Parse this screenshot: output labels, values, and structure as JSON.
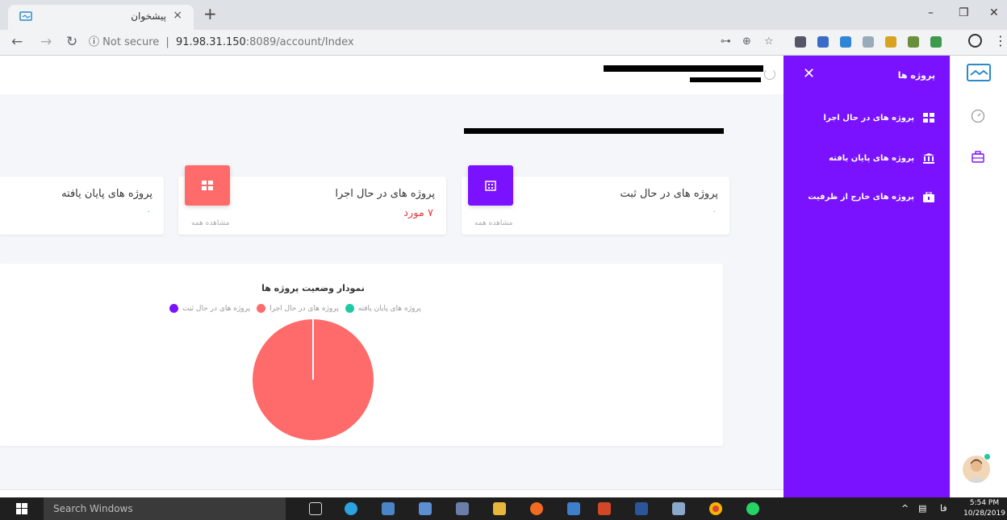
{
  "browser": {
    "tab_title": "پیشخوان",
    "tab_close": "×",
    "new_tab": "+",
    "url_security": "Not secure",
    "url_separator": "|",
    "url_host": "91.98.31.150",
    "url_rest": ":8089/account/Index",
    "window_controls": [
      "–",
      "❐",
      "✕"
    ]
  },
  "header": {},
  "cards": [
    {
      "title": "پروژه های در حال ثبت",
      "value": "۰",
      "link": "مشاهده همه",
      "badge_color": "#7a12ff"
    },
    {
      "title": "پروژه های در حال اجرا",
      "value": "۷ مورد",
      "link": "مشاهده همه",
      "badge_color": "#ff6a6a"
    },
    {
      "title": "پروژه های پایان یافته",
      "value": "۰",
      "link": "",
      "badge_color": "#ffffff"
    }
  ],
  "chart": {
    "title": "نمودار وضعیت پروژه ها",
    "legend": [
      {
        "label": "پروژه های پایان یافته",
        "color": "#1ec9a4"
      },
      {
        "label": "پروژه های در حال اجرا",
        "color": "#ff6b6b"
      },
      {
        "label": "پروژه های در حال ثبت",
        "color": "#7a12ff"
      }
    ]
  },
  "chart_data": {
    "type": "pie",
    "title": "نمودار وضعیت پروژه ها",
    "categories": [
      "پروژه های پایان یافته",
      "پروژه های در حال اجرا",
      "پروژه های در حال ثبت"
    ],
    "values": [
      0,
      7,
      0
    ],
    "colors": [
      "#1ec9a4",
      "#ff6b6b",
      "#7a12ff"
    ],
    "legend_position": "top"
  },
  "sidebar": {
    "title": "پروژه ها",
    "close": "✕",
    "items": [
      {
        "label": "پروژه های در حال اجرا",
        "icon": "grid-plus-icon"
      },
      {
        "label": "پروژه های پایان یافته",
        "icon": "bank-icon"
      },
      {
        "label": "پروژه های خارج از ظرفیت",
        "icon": "bag-icon"
      }
    ]
  },
  "taskbar": {
    "search_placeholder": "Search Windows",
    "language": "فا",
    "time": "5:54 PM",
    "date": "10/28/2019"
  }
}
